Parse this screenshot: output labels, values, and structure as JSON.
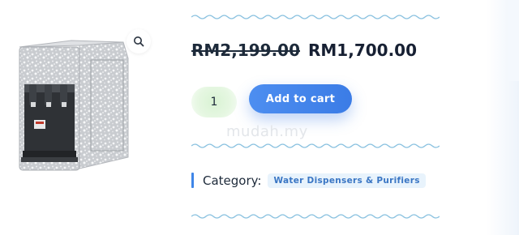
{
  "product": {
    "old_price": "RM2,199.00",
    "price": "RM1,700.00",
    "quantity": "1",
    "add_to_cart_label": "Add to cart",
    "category_label": "Category:",
    "category_tag": "Water Dispensers & Purifiers"
  },
  "watermark": {
    "text": "mudah.my"
  },
  "icons": {
    "zoom": "magnifier-icon"
  },
  "colors": {
    "accent": "#3f86e8",
    "button": "#4688ee",
    "wave": "#8bc2e0",
    "tag_bg": "#e8f3fc",
    "tag_text": "#3a76c4",
    "qty_bg": "#d9f3d4"
  }
}
